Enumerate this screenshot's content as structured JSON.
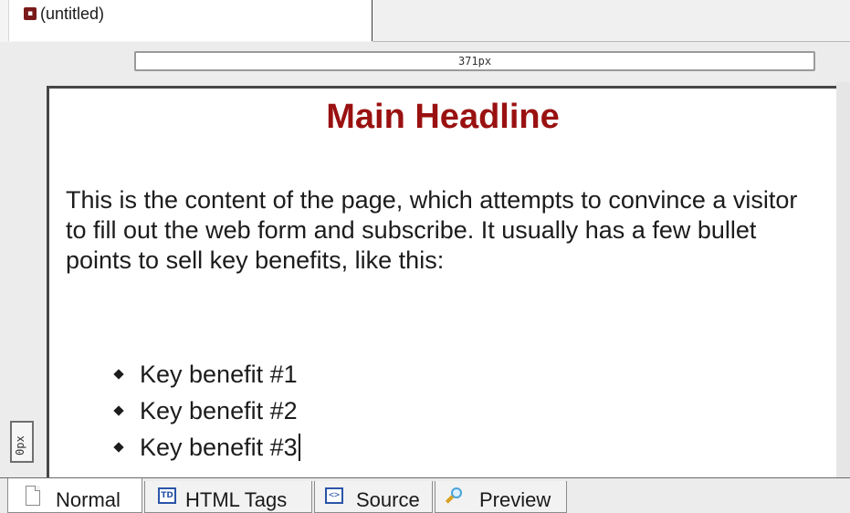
{
  "document": {
    "tab_title": "(untitled)",
    "icon": "document-icon"
  },
  "rulers": {
    "width_label": "371px",
    "height_label": "0px"
  },
  "content": {
    "headline": "Main Headline",
    "headline_color": "#9a1111",
    "paragraph": "This is the content of the page, which attempts to convince a visitor to fill out the web form and subscribe. It usually has a few bullet points to sell key benefits, like this:",
    "benefits": [
      "Key benefit #1",
      "Key benefit #2",
      "Key benefit #3"
    ]
  },
  "view_tabs": [
    {
      "label": "Normal",
      "icon": "page-icon",
      "active": true
    },
    {
      "label": "HTML Tags",
      "icon": "td-icon",
      "icon_text": "TD",
      "active": false
    },
    {
      "label": "Source",
      "icon": "source-icon",
      "icon_text": "<>",
      "active": false
    },
    {
      "label": "Preview",
      "icon": "magnifier-icon",
      "active": false
    }
  ]
}
